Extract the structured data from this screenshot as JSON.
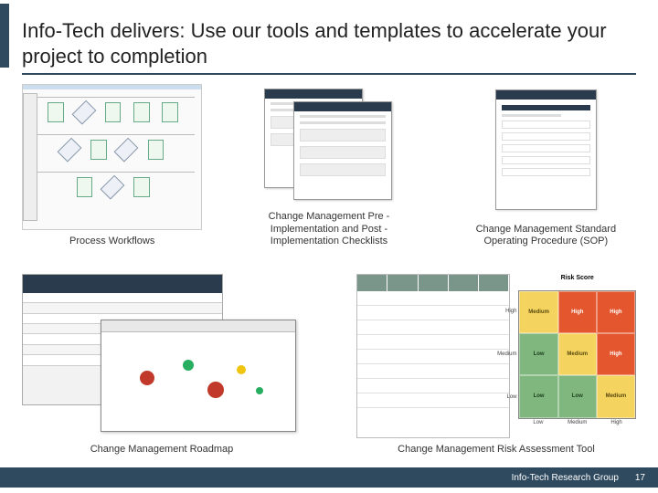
{
  "title": "Info-Tech delivers: Use our tools and templates to accelerate your project to completion",
  "items": {
    "workflow": {
      "caption": "Process Workflows"
    },
    "checklists": {
      "caption": "Change Management Pre -Implementation and Post -Implementation Checklists"
    },
    "sop": {
      "caption": "Change Management Standard Operating Procedure (SOP)"
    },
    "roadmap": {
      "caption": "Change Management Roadmap"
    },
    "risk": {
      "caption": "Change Management Risk Assessment Tool",
      "matrix_title": "Risk Score",
      "y_labels": [
        "High",
        "Medium",
        "Low"
      ],
      "x_labels": [
        "Low",
        "Medium",
        "High"
      ],
      "cells": [
        [
          "Medium",
          "High",
          "High"
        ],
        [
          "Low",
          "Medium",
          "High"
        ],
        [
          "Low",
          "Low",
          "Medium"
        ]
      ]
    }
  },
  "footer": {
    "org": "Info-Tech Research Group",
    "page": "17"
  }
}
